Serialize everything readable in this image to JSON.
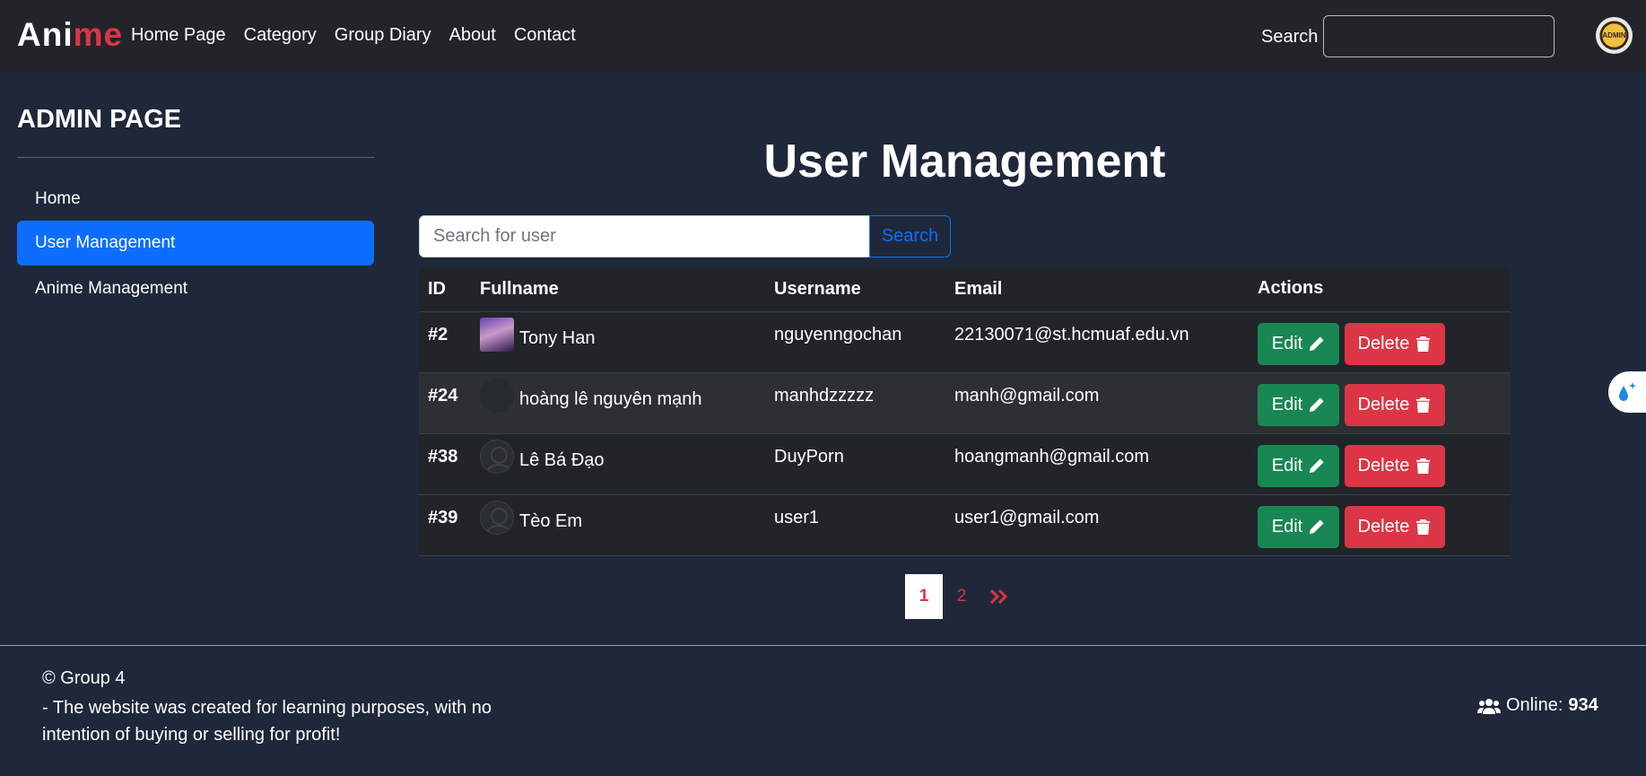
{
  "navbar": {
    "logo_part1": "Ani",
    "logo_part2": "me",
    "links": [
      "Home Page",
      "Category",
      "Group Diary",
      "About",
      "Contact"
    ],
    "search_label": "Search",
    "avatar_text": "ADMIN"
  },
  "sidebar": {
    "title": "ADMIN PAGE",
    "items": [
      {
        "label": "Home"
      },
      {
        "label": "User Management"
      },
      {
        "label": "Anime Management"
      }
    ]
  },
  "main": {
    "title": "User Management",
    "search_placeholder": "Search for user",
    "search_button": "Search",
    "table": {
      "headers": [
        "ID",
        "Fullname",
        "Username",
        "Email",
        "Actions"
      ],
      "rows": [
        {
          "id": "#2",
          "fullname": "Tony Han",
          "username": "nguyenngochan",
          "email": "22130071@st.hcmuaf.edu.vn"
        },
        {
          "id": "#24",
          "fullname": "hoàng lê nguyên mạnh",
          "username": "manhdzzzzz",
          "email": "manh@gmail.com"
        },
        {
          "id": "#38",
          "fullname": "Lê Bá Đạo",
          "username": "DuyPorn",
          "email": "hoangmanh@gmail.com"
        },
        {
          "id": "#39",
          "fullname": "Tèo Em",
          "username": "user1",
          "email": "user1@gmail.com"
        }
      ],
      "edit_label": "Edit",
      "delete_label": "Delete"
    },
    "pagination": {
      "pages": [
        "1",
        "2"
      ],
      "next": "»",
      "current": "1"
    }
  },
  "footer": {
    "copyright": "© Group 4",
    "note": "- The website was created for learning purposes, with no intention of buying or selling for profit!",
    "online_label": "Online:",
    "online_count": "934"
  },
  "colors": {
    "accent": "#0d6efd",
    "danger": "#dc3545",
    "success": "#198754",
    "navbar": "#212529",
    "page_bg": "#1f283a"
  }
}
